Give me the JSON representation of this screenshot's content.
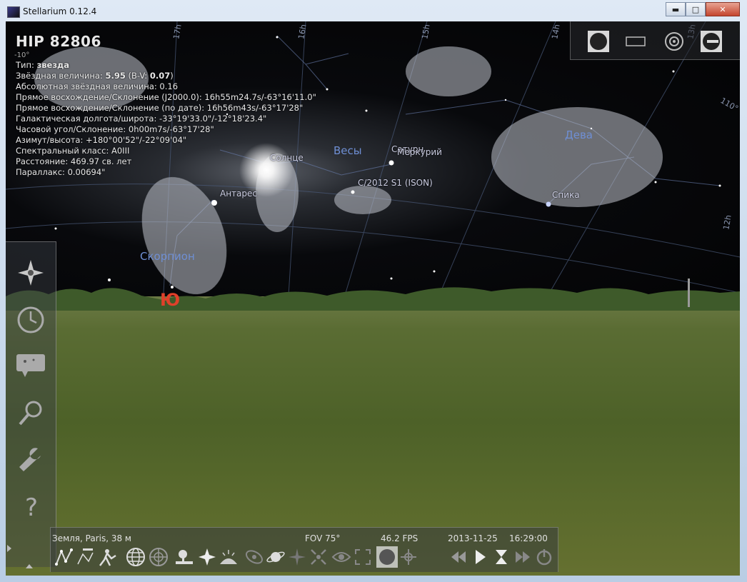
{
  "window": {
    "title": "Stellarium 0.12.4",
    "controls": {
      "minimize": "▬",
      "maximize": "□",
      "close": "✕"
    }
  },
  "object_info": {
    "name": "HIP 82806",
    "grid_mark": "-10°",
    "lines": [
      {
        "label": "Тип: ",
        "value": "звезда",
        "bold": true
      },
      {
        "label": "Звёздная величина: ",
        "value": "5.95",
        "suffix": " (B-V: ",
        "value2": "0.07",
        "tail": ")"
      },
      {
        "label": "Абсолютная звёздная величина: 0.16"
      },
      {
        "label": "Прямое восхождение/Склонение (J2000.0): 16h55m24.7s/-63°16'11.0\""
      },
      {
        "label": "Прямое восхождение/Склонение (по дате): 16h56m43s/-63°17'28\""
      },
      {
        "label": "Галактическая долгота/широта: -33°19'33.0\"/-12°18'23.4\""
      },
      {
        "label": "Часовой угол/Склонение: 0h00m7s/-63°17'28\""
      },
      {
        "label": "Азимут/высота: +180°00'52\"/-22°09'04\""
      },
      {
        "label": "Спектральный класс: A0III"
      },
      {
        "label": "Расстояние: 469.97 св. лет"
      },
      {
        "label": "Параллакс: 0.00694\""
      }
    ]
  },
  "sky_labels": {
    "sun": "Солнце",
    "antares": "Антарес",
    "saturn": "Сатурн",
    "mercury": "Меркурий",
    "comet": "C/2012 S1 (ISON)",
    "spica": "Спика",
    "south": "Ю"
  },
  "constellations": {
    "libra": "Весы",
    "virgo": "Дева",
    "scorpius": "Скорпион"
  },
  "grid_labels": [
    "17h",
    "16h",
    "15h",
    "14h",
    "13h",
    "110°",
    "12h"
  ],
  "status": {
    "location": "Земля, Paris, 38 м",
    "fov": "FOV 75°",
    "fps": "46.2 FPS",
    "date": "2013-11-25",
    "time": "16:29:00"
  },
  "colors": {
    "constellation_name": "#6f8fd4",
    "south_marker": "#e0402a",
    "sun_glow": "#ffffff"
  }
}
